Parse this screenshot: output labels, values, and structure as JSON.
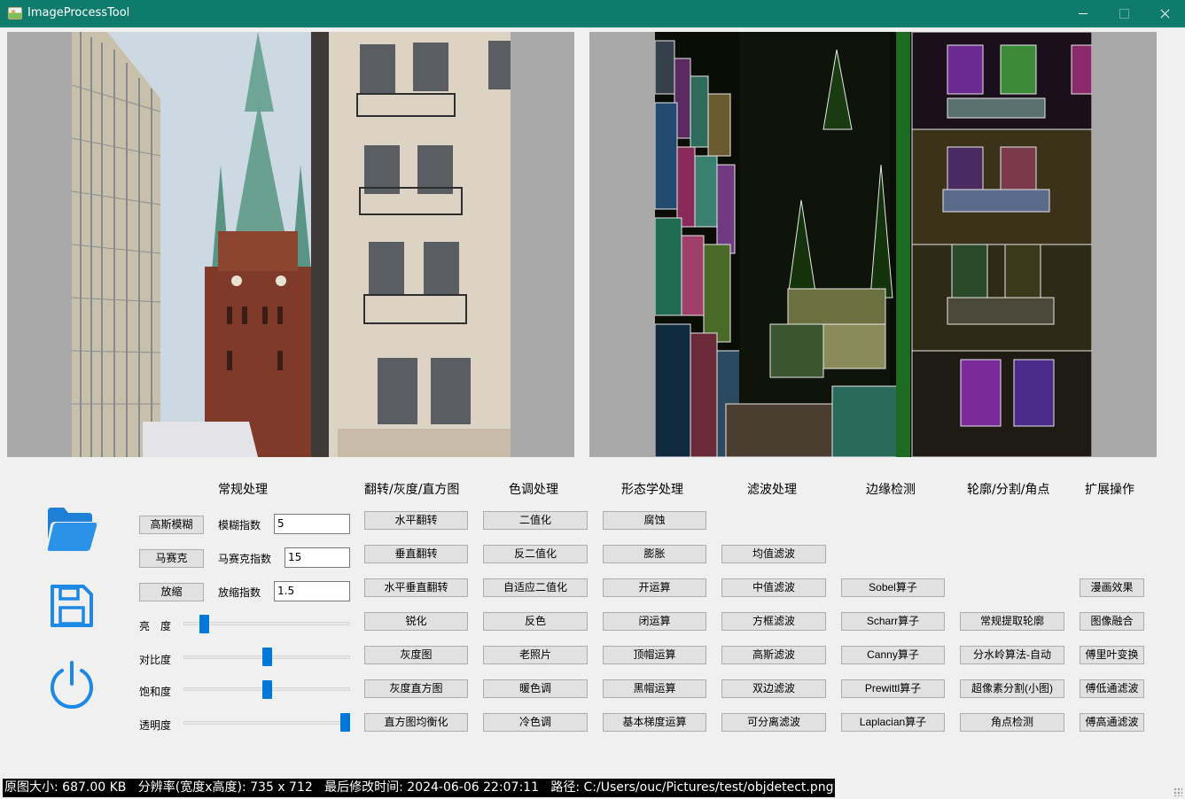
{
  "window": {
    "title": "ImageProcessTool",
    "accent_color": "#0f7b6c",
    "controls": [
      "minimize-icon",
      "maximize-icon",
      "close-icon"
    ]
  },
  "sidebar_icons": [
    "folder-open-icon",
    "save-floppy-icon",
    "power-icon"
  ],
  "sections": {
    "regular": "常规处理",
    "flip": "翻转/灰度/直方图",
    "tone": "色调处理",
    "morph": "形态学处理",
    "filter": "滤波处理",
    "edge": "边缘检测",
    "contour": "轮廓/分割/角点",
    "extend": "扩展操作"
  },
  "regular": {
    "blur_button": "高斯模糊",
    "blur_label": "模糊指数",
    "blur_value": "5",
    "mosaic_button": "马赛克",
    "mosaic_label": "马赛克指数",
    "mosaic_value": "15",
    "scale_button": "放缩",
    "scale_label": "放缩指数",
    "scale_value": "1.5",
    "sliders": [
      {
        "label": "亮　度",
        "value": 0.1
      },
      {
        "label": "对比度",
        "value": 0.5
      },
      {
        "label": "饱和度",
        "value": 0.5
      },
      {
        "label": "透明度",
        "value": 1.0
      }
    ]
  },
  "flip_buttons": [
    "水平翻转",
    "垂直翻转",
    "水平垂直翻转",
    "锐化",
    "灰度图",
    "灰度直方图",
    "直方图均衡化"
  ],
  "tone_buttons": [
    "二值化",
    "反二值化",
    "自适应二值化",
    "反色",
    "老照片",
    "暖色调",
    "冷色调"
  ],
  "morph_buttons": [
    "腐蚀",
    "膨胀",
    "开运算",
    "闭运算",
    "顶帽运算",
    "黑帽运算",
    "基本梯度运算"
  ],
  "filter_buttons": [
    "均值滤波",
    "中值滤波",
    "方框滤波",
    "高斯滤波",
    "双边滤波",
    "可分离滤波"
  ],
  "edge_buttons": [
    "Sobel算子",
    "Scharr算子",
    "Canny算子",
    "Prewittl算子",
    "Laplacian算子"
  ],
  "contour_buttons": [
    "常规提取轮廓",
    "分水岭算法-自动",
    "超像素分割(小图)",
    "角点检测"
  ],
  "extend_buttons": [
    "漫画效果",
    "图像融合",
    "傅里叶变换",
    "傅低通滤波",
    "傅高通滤波"
  ],
  "status": {
    "size": "原图大小: 687.00 KB",
    "resolution": "分辨率(宽度x高度): 735 x 712",
    "modified": "最后修改时间: 2024-06-06 22:07:11",
    "path": "路径: C:/Users/ouc/Pictures/test/objdetect.png"
  }
}
